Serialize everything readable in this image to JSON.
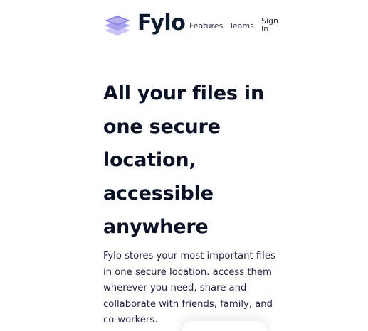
{
  "brand": {
    "name": "Fylo",
    "logo_icon": "stacked-layers-icon",
    "accent": "#a8a4f0"
  },
  "nav": {
    "items": [
      {
        "label": "Features"
      },
      {
        "label": "Teams"
      },
      {
        "label": "Sign In"
      }
    ]
  },
  "hero": {
    "title": "All your files in one secure location, accessible anywhere",
    "description": "Fylo stores your most important files in one secure location. access them wherever you need, share and collaborate with friends, family, and co-workers."
  }
}
